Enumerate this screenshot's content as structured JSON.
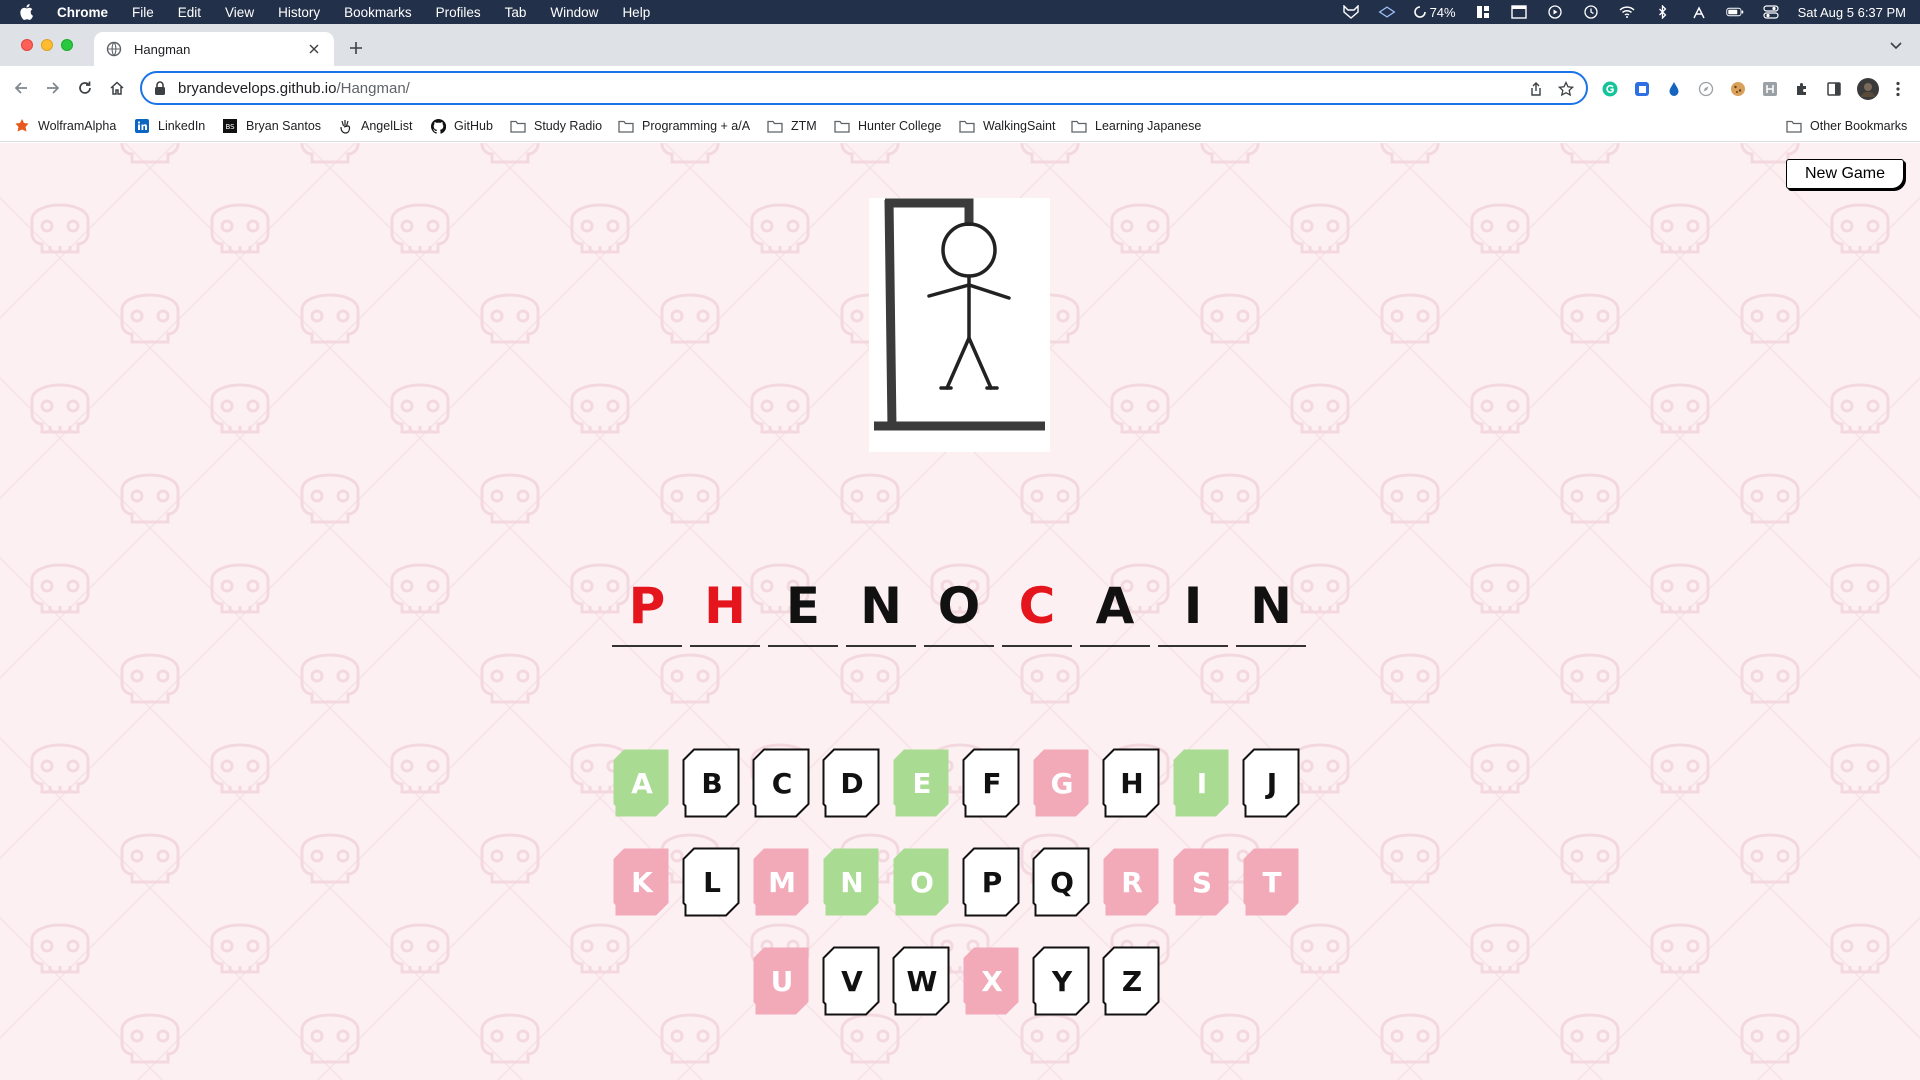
{
  "menubar": {
    "app": "Chrome",
    "items": [
      "File",
      "Edit",
      "View",
      "History",
      "Bookmarks",
      "Profiles",
      "Tab",
      "Window",
      "Help"
    ],
    "battery": "74%",
    "datetime": "Sat Aug 5  6:37 PM"
  },
  "tab": {
    "title": "Hangman"
  },
  "omnibox": {
    "host": "bryandevelops.github.io",
    "path": "/Hangman/"
  },
  "bookmarks": [
    {
      "label": "WolframAlpha",
      "icon": "wolfram-icon"
    },
    {
      "label": "LinkedIn",
      "icon": "linkedin-icon"
    },
    {
      "label": "Bryan Santos",
      "icon": "bs-icon"
    },
    {
      "label": "AngelList",
      "icon": "angellist-icon"
    },
    {
      "label": "GitHub",
      "icon": "github-icon"
    },
    {
      "label": "Study Radio",
      "icon": "folder-icon"
    },
    {
      "label": "Programming + a/A",
      "icon": "folder-icon"
    },
    {
      "label": "ZTM",
      "icon": "folder-icon"
    },
    {
      "label": "Hunter College",
      "icon": "folder-icon"
    },
    {
      "label": "WalkingSaint",
      "icon": "folder-icon"
    },
    {
      "label": "Learning Japanese",
      "icon": "folder-icon"
    }
  ],
  "other_bookmarks": "Other Bookmarks",
  "game": {
    "new_game_label": "New Game",
    "word": [
      {
        "letter": "P",
        "state": "missed"
      },
      {
        "letter": "H",
        "state": "missed"
      },
      {
        "letter": "E",
        "state": "guessed"
      },
      {
        "letter": "N",
        "state": "guessed"
      },
      {
        "letter": "O",
        "state": "guessed"
      },
      {
        "letter": "C",
        "state": "missed"
      },
      {
        "letter": "A",
        "state": "guessed"
      },
      {
        "letter": "I",
        "state": "guessed"
      },
      {
        "letter": "N",
        "state": "guessed"
      }
    ],
    "keyboard": [
      [
        {
          "letter": "A",
          "state": "correct"
        },
        {
          "letter": "B",
          "state": "unused"
        },
        {
          "letter": "C",
          "state": "unused"
        },
        {
          "letter": "D",
          "state": "unused"
        },
        {
          "letter": "E",
          "state": "correct"
        },
        {
          "letter": "F",
          "state": "unused"
        },
        {
          "letter": "G",
          "state": "wrong"
        },
        {
          "letter": "H",
          "state": "unused"
        },
        {
          "letter": "I",
          "state": "correct"
        },
        {
          "letter": "J",
          "state": "unused"
        }
      ],
      [
        {
          "letter": "K",
          "state": "wrong"
        },
        {
          "letter": "L",
          "state": "unused"
        },
        {
          "letter": "M",
          "state": "wrong"
        },
        {
          "letter": "N",
          "state": "correct"
        },
        {
          "letter": "O",
          "state": "correct"
        },
        {
          "letter": "P",
          "state": "unused"
        },
        {
          "letter": "Q",
          "state": "unused"
        },
        {
          "letter": "R",
          "state": "wrong"
        },
        {
          "letter": "S",
          "state": "wrong"
        },
        {
          "letter": "T",
          "state": "wrong"
        }
      ],
      [
        {
          "letter": "U",
          "state": "wrong"
        },
        {
          "letter": "V",
          "state": "unused"
        },
        {
          "letter": "W",
          "state": "unused"
        },
        {
          "letter": "X",
          "state": "wrong"
        },
        {
          "letter": "Y",
          "state": "unused"
        },
        {
          "letter": "Z",
          "state": "unused"
        }
      ]
    ]
  },
  "colors": {
    "page_bg": "#fdf0f3",
    "correct": "#a9dc92",
    "wrong": "#f2a9b8",
    "missed_letter": "#e4151c",
    "omnibox_focus": "#1a73e8"
  }
}
